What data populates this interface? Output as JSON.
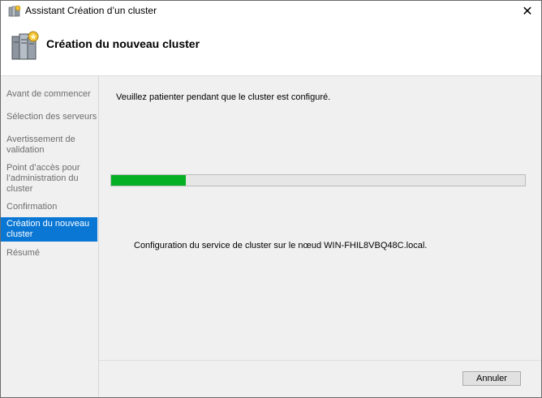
{
  "window": {
    "title": "Assistant Création d’un cluster"
  },
  "header": {
    "title": "Création du nouveau cluster"
  },
  "sidebar": {
    "steps": [
      {
        "label": "Avant de commencer",
        "active": false
      },
      {
        "label": "Sélection des serveurs",
        "active": false
      },
      {
        "label": "Avertissement de validation",
        "active": false
      },
      {
        "label": "Point d’accès pour l’administration du cluster",
        "active": false
      },
      {
        "label": "Confirmation",
        "active": false
      },
      {
        "label": "Création du nouveau cluster",
        "active": true
      },
      {
        "label": "Résumé",
        "active": false
      }
    ]
  },
  "main": {
    "wait_message": "Veuillez patienter pendant que le cluster est configuré.",
    "progress_percent": 18,
    "status_message": "Configuration du service de cluster sur le nœud WIN-FHIL8VBQ48C.local."
  },
  "footer": {
    "cancel_label": "Annuler"
  },
  "colors": {
    "accent": "#0a77d5",
    "progress": "#06b025",
    "panel": "#f0f0f0"
  },
  "icons": {
    "title": "cluster-wizard-icon",
    "header": "server-cluster-icon",
    "close": "close-icon"
  }
}
